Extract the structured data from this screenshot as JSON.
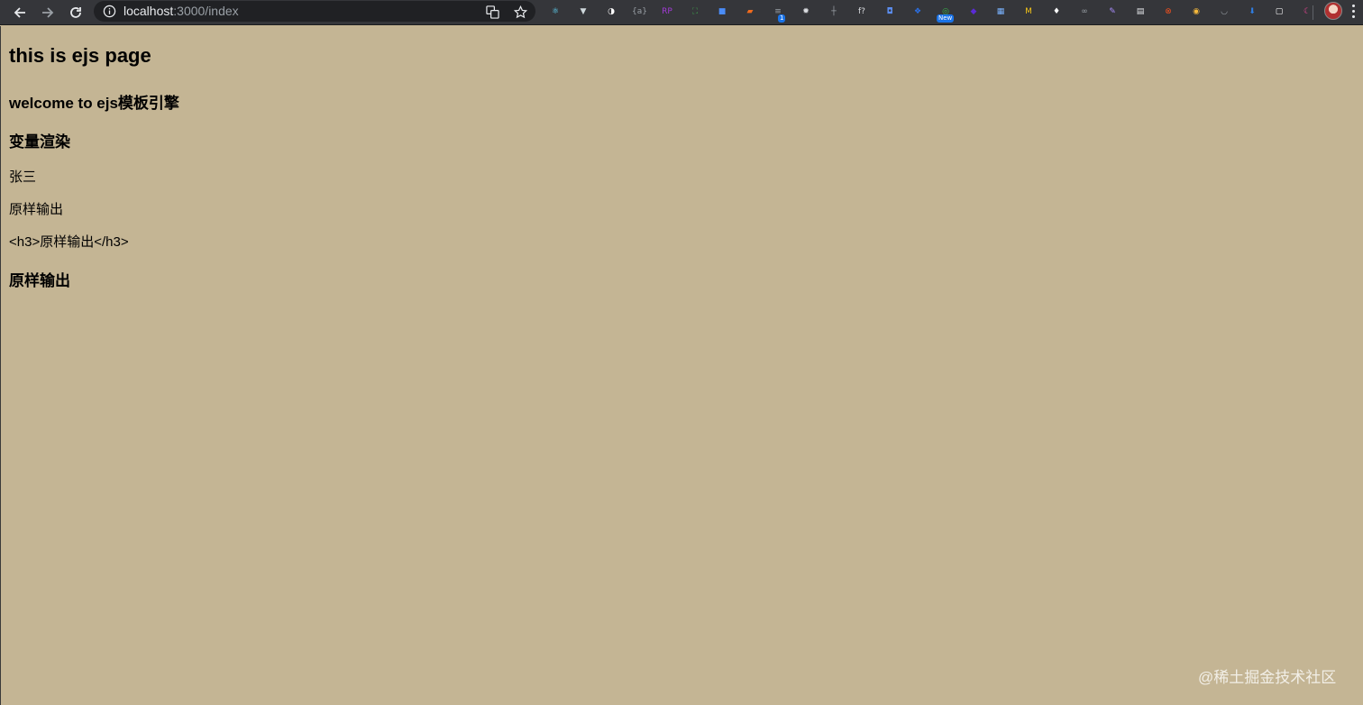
{
  "browser": {
    "url_host": "localhost",
    "url_path": ":3000/index",
    "extensions": [
      {
        "name": "react-devtools",
        "color": "#61dafb",
        "glyph": "⚛"
      },
      {
        "name": "vue-devtools",
        "color": "#cfd8dc",
        "glyph": "▼"
      },
      {
        "name": "extension-circle",
        "color": "#ffffff",
        "glyph": "◑"
      },
      {
        "name": "json-viewer",
        "color": "#9aa0a6",
        "glyph": "{a}"
      },
      {
        "name": "rp-extension",
        "color": "#a23bd6",
        "glyph": "RP"
      },
      {
        "name": "screenshot-extension",
        "color": "#3fa34d",
        "glyph": "⛶"
      },
      {
        "name": "blue-square-extension",
        "color": "#4a8cf7",
        "glyph": "■"
      },
      {
        "name": "orange-extension",
        "color": "#f26b1d",
        "glyph": "▰"
      },
      {
        "name": "database-extension",
        "color": "#9aa0a6",
        "glyph": "≡",
        "badge": "1"
      },
      {
        "name": "gear-extension",
        "color": "#dadce0",
        "glyph": "✹"
      },
      {
        "name": "ruler-extension",
        "color": "#9aa0a6",
        "glyph": "┼"
      },
      {
        "name": "function-extension",
        "color": "#dadce0",
        "glyph": "f?"
      },
      {
        "name": "camera-extension",
        "color": "#5b8def",
        "glyph": "◘"
      },
      {
        "name": "dropbox-extension",
        "color": "#2b71e8",
        "glyph": "❖"
      },
      {
        "name": "new-extension",
        "color": "#3ab54a",
        "glyph": "◎",
        "badge": "New"
      },
      {
        "name": "purple-cube-extension",
        "color": "#5b2bd6",
        "glyph": "◆"
      },
      {
        "name": "puzzle-extension",
        "color": "#7ab3ff",
        "glyph": "▦"
      },
      {
        "name": "m-extension",
        "color": "#f5c518",
        "glyph": "M"
      },
      {
        "name": "diamond-extension",
        "color": "#ffffff",
        "glyph": "♦"
      },
      {
        "name": "link-extension",
        "color": "#9aa0a6",
        "glyph": "∞"
      },
      {
        "name": "feather-extension",
        "color": "#a78bfa",
        "glyph": "✎"
      },
      {
        "name": "note-extension",
        "color": "#e8eaed",
        "glyph": "▤"
      },
      {
        "name": "orange-circle-extension",
        "color": "#f4511e",
        "glyph": "⊗"
      },
      {
        "name": "chrome-circle-extension",
        "color": "#f6b93b",
        "glyph": "◉"
      },
      {
        "name": "pocket-extension",
        "color": "#9aa0a6",
        "glyph": "◡"
      },
      {
        "name": "download-extension",
        "color": "#2f7de1",
        "glyph": "⬇"
      },
      {
        "name": "screenshot-white-extension",
        "color": "#ffffff",
        "glyph": "▢"
      },
      {
        "name": "moon-extension",
        "color": "#e84393",
        "glyph": "☾"
      }
    ]
  },
  "page": {
    "title": "this is ejs page",
    "subtitle": "welcome to ejs模板引擎",
    "section_heading": "变量渲染",
    "name_value": "张三",
    "raw_label": "原样输出",
    "escaped_html": "<h3>原样输出</h3>",
    "rendered_html": "原样输出"
  },
  "watermark": "@稀土掘金技术社区"
}
